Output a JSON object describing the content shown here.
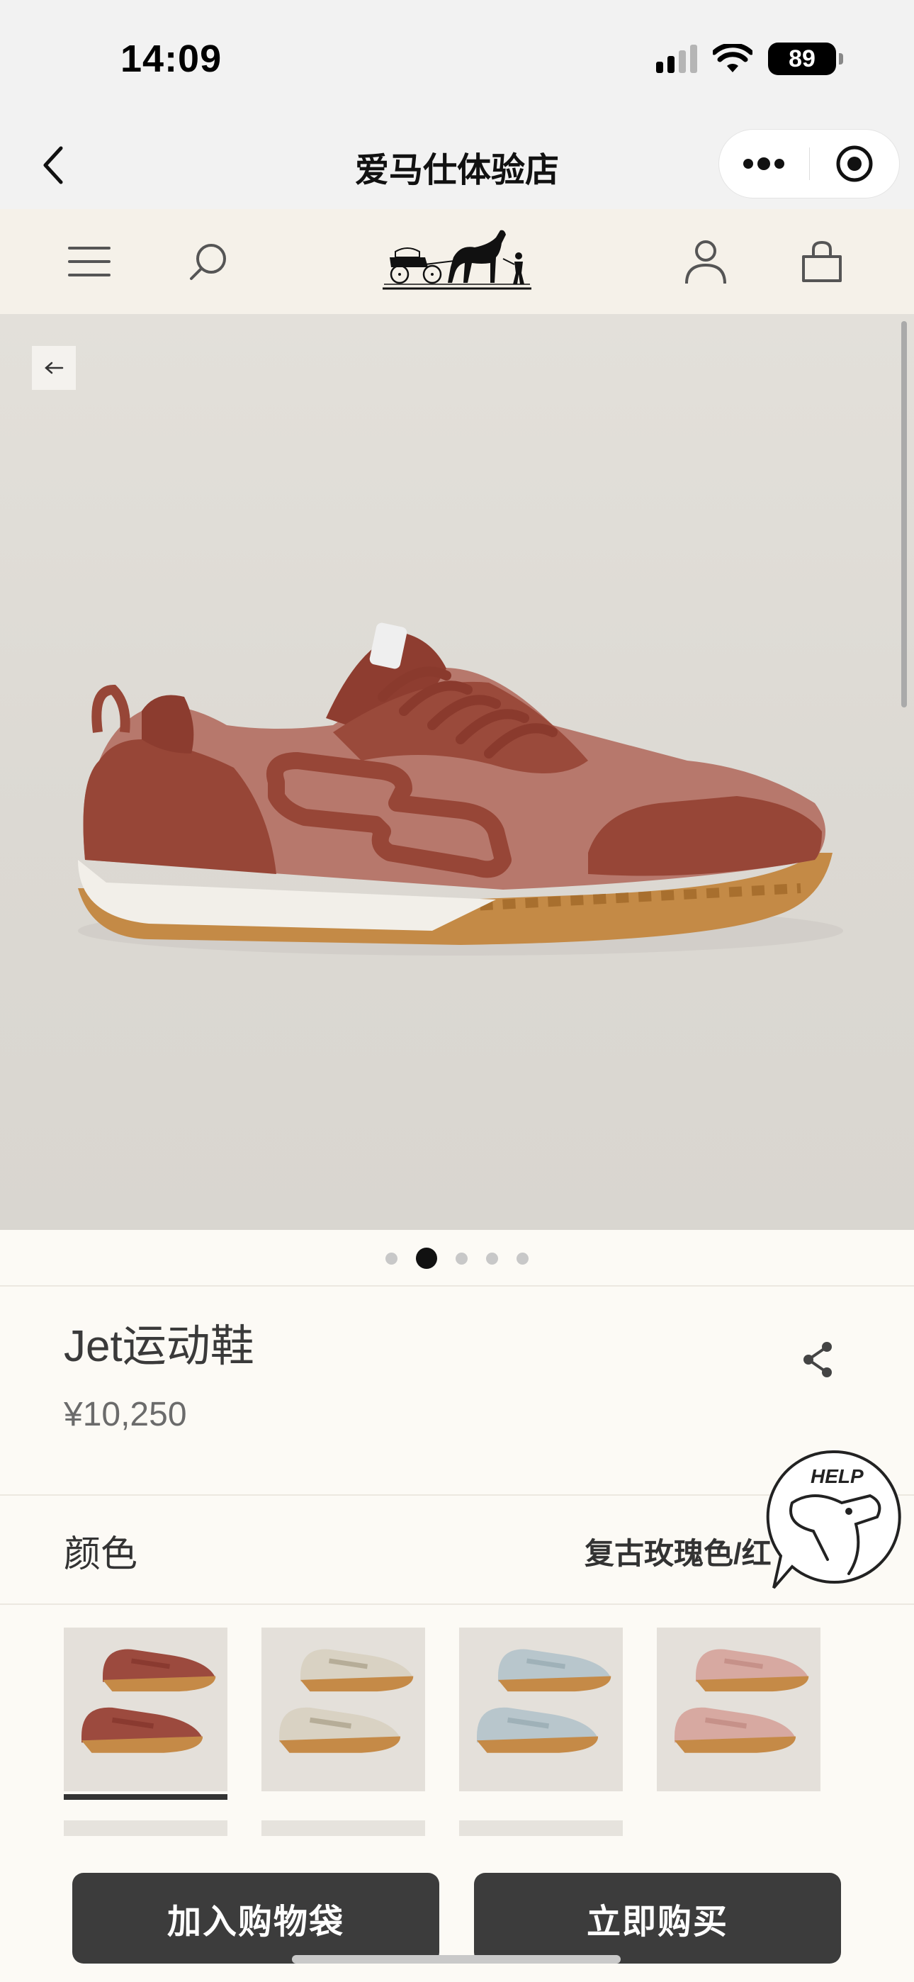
{
  "status_bar": {
    "time": "14:09",
    "battery": "89"
  },
  "mini_program": {
    "title": "爱马仕体验店"
  },
  "product": {
    "name": "Jet运动鞋",
    "price": "¥10,250",
    "color_label": "颜色",
    "color_value": "复古玫瑰色/红",
    "image_count": 5,
    "active_image_index": 1
  },
  "swatches": [
    {
      "name": "复古玫瑰色/红",
      "upper": "#9c4a3e",
      "accent": "#8a3a30",
      "sole": "#c58a47",
      "selected": true
    },
    {
      "name": "beige",
      "upper": "#d9d2c3",
      "accent": "#b6ad98",
      "sole": "#c58a47",
      "selected": false
    },
    {
      "name": "blue",
      "upper": "#b8c6cc",
      "accent": "#9fb1b8",
      "sole": "#c58a47",
      "selected": false
    },
    {
      "name": "pink",
      "upper": "#d7a9a1",
      "accent": "#c69189",
      "sole": "#c58a47",
      "selected": false
    }
  ],
  "actions": {
    "add_to_bag": "加入购物袋",
    "buy_now": "立即购买"
  },
  "help": {
    "label": "HELP"
  },
  "colors": {
    "button": "#3c3c3c",
    "header_bg": "#f5f1e9",
    "page_bg": "#fcfaf5"
  }
}
